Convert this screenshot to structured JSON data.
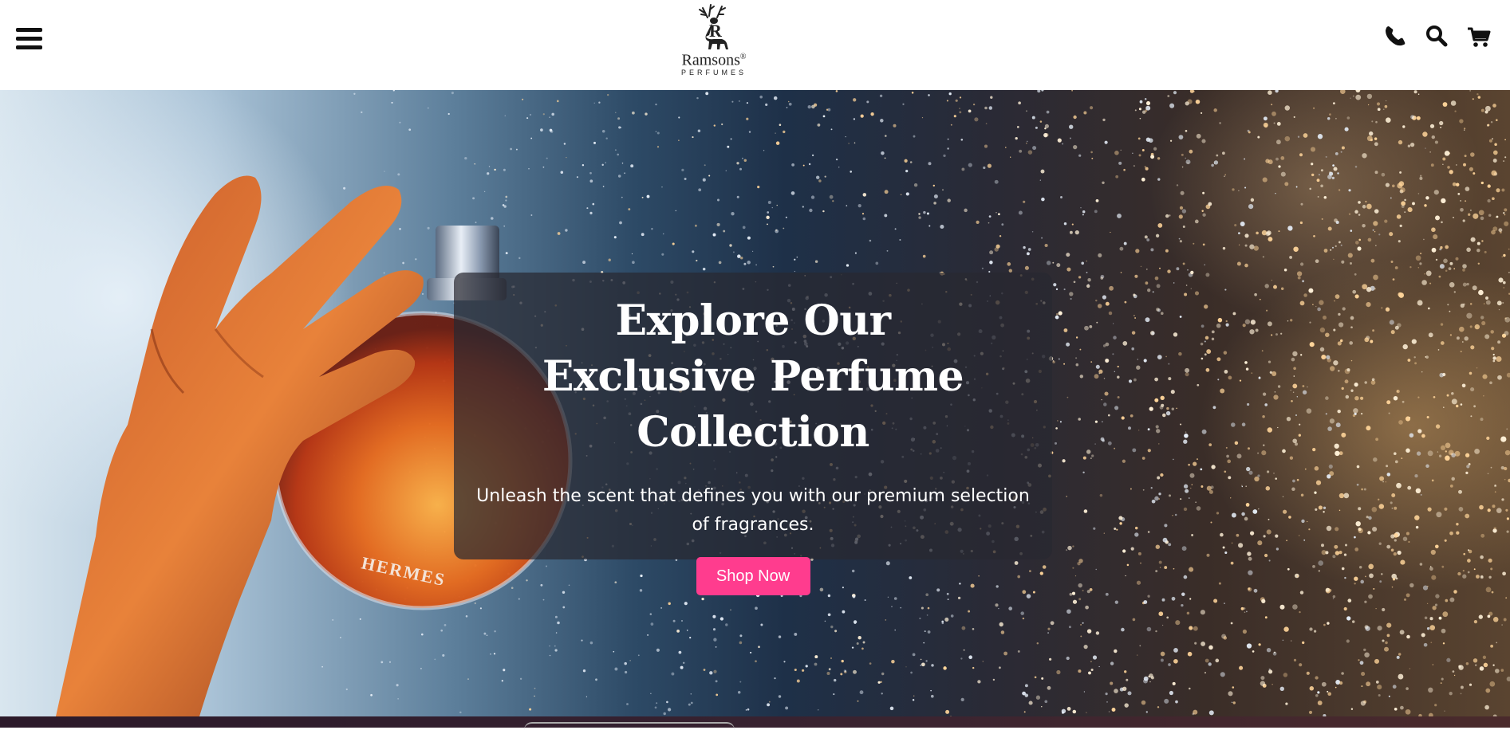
{
  "header": {
    "menu_icon": "hamburger-menu-icon",
    "logo": {
      "name": "Ramsons",
      "registered": "®",
      "subtitle": "PERFUMES",
      "icon": "stag-logo-icon"
    },
    "actions": [
      {
        "icon": "phone-icon"
      },
      {
        "icon": "search-icon"
      },
      {
        "icon": "cart-icon"
      }
    ]
  },
  "hero": {
    "title": "Explore Our Exclusive Perfume Collection",
    "subtitle": "Unleash the scent that defines you with our premium selection of fragrances.",
    "cta_label": "Shop Now",
    "bottle_label": "HERMES"
  },
  "colors": {
    "accent": "#ff3c8e",
    "card_bg": "rgba(40,40,48,0.72)",
    "text_dark": "#111111"
  }
}
